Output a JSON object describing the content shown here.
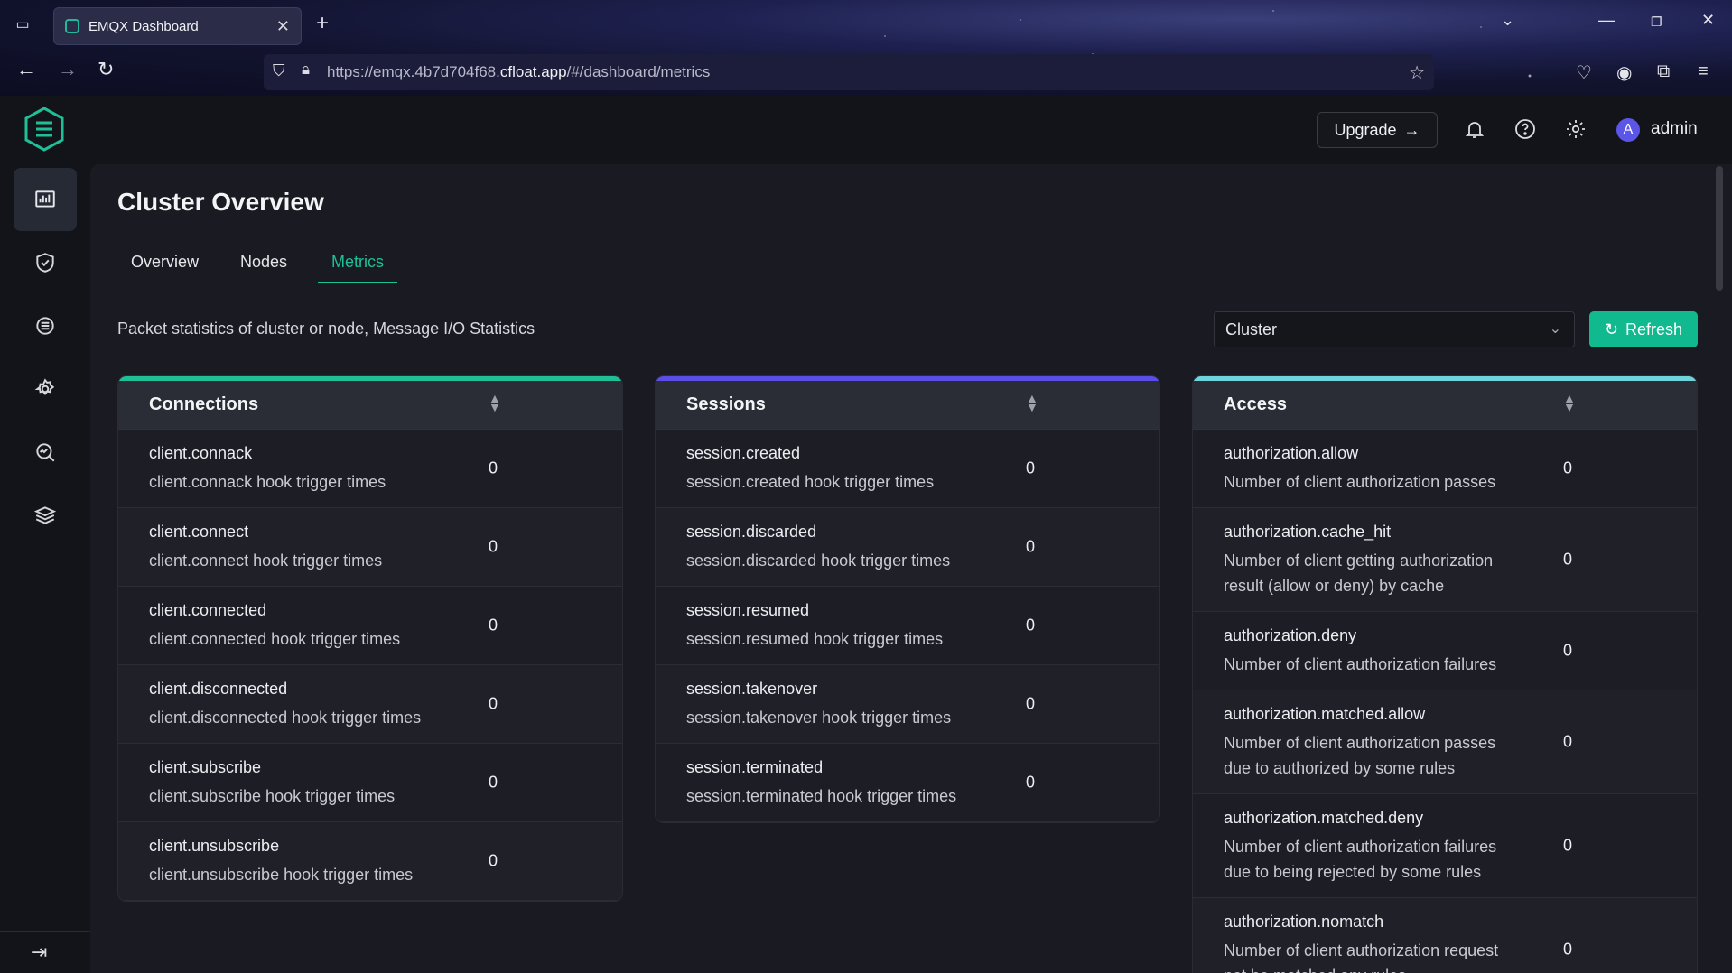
{
  "browser": {
    "tab_title": "EMQX Dashboard",
    "url_prefix": "https://emqx.4b7d704f68.",
    "url_domain": "cfloat.app",
    "url_path": "/#/dashboard/metrics"
  },
  "header": {
    "upgrade_label": "Upgrade",
    "user_initial": "A",
    "user_name": "admin"
  },
  "page": {
    "title": "Cluster Overview",
    "tabs": [
      {
        "label": "Overview"
      },
      {
        "label": "Nodes"
      },
      {
        "label": "Metrics",
        "active": true
      }
    ],
    "description": "Packet statistics of cluster or node, Message I/O Statistics",
    "select_value": "Cluster",
    "refresh_label": "Refresh"
  },
  "colors": {
    "accent": "#1fbf97",
    "connections_bar": "#1fbf97",
    "sessions_bar": "#5b4ee6",
    "access_bar": "#6fd3dc"
  },
  "cards": {
    "connections": {
      "title": "Connections",
      "rows": [
        {
          "name": "client.connack",
          "desc": "client.connack hook trigger times",
          "value": "0"
        },
        {
          "name": "client.connect",
          "desc": "client.connect hook trigger times",
          "value": "0"
        },
        {
          "name": "client.connected",
          "desc": "client.connected hook trigger times",
          "value": "0"
        },
        {
          "name": "client.disconnected",
          "desc": "client.disconnected hook trigger times",
          "value": "0"
        },
        {
          "name": "client.subscribe",
          "desc": "client.subscribe hook trigger times",
          "value": "0"
        },
        {
          "name": "client.unsubscribe",
          "desc": "client.unsubscribe hook trigger times",
          "value": "0"
        }
      ]
    },
    "sessions": {
      "title": "Sessions",
      "rows": [
        {
          "name": "session.created",
          "desc": "session.created hook trigger times",
          "value": "0"
        },
        {
          "name": "session.discarded",
          "desc": "session.discarded hook trigger times",
          "value": "0"
        },
        {
          "name": "session.resumed",
          "desc": "session.resumed hook trigger times",
          "value": "0"
        },
        {
          "name": "session.takenover",
          "desc": "session.takenover hook trigger times",
          "value": "0"
        },
        {
          "name": "session.terminated",
          "desc": "session.terminated hook trigger times",
          "value": "0"
        }
      ]
    },
    "access": {
      "title": "Access",
      "rows": [
        {
          "name": "authorization.allow",
          "desc": "Number of client authorization passes",
          "value": "0"
        },
        {
          "name": "authorization.cache_hit",
          "desc": "Number of client getting authorization result (allow or deny) by cache",
          "value": "0"
        },
        {
          "name": "authorization.deny",
          "desc": "Number of client authorization failures",
          "value": "0"
        },
        {
          "name": "authorization.matched.allow",
          "desc": "Number of client authorization passes due to authorized by some rules",
          "value": "0"
        },
        {
          "name": "authorization.matched.deny",
          "desc": "Number of client authorization failures due to being rejected by some rules",
          "value": "0"
        },
        {
          "name": "authorization.nomatch",
          "desc": "Number of client authorization request not be matched any rules",
          "value": "0"
        }
      ]
    }
  }
}
